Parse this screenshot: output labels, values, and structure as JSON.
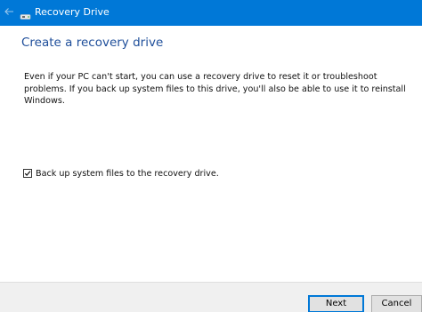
{
  "window": {
    "title": "Recovery Drive"
  },
  "main": {
    "heading": "Create a recovery drive",
    "description": "Even if your PC can't start, you can use a recovery drive to reset it or troubleshoot problems. If you back up system files to this drive, you'll also be able to use it to reinstall Windows.",
    "backup_checkbox": {
      "label": "Back up system files to the recovery drive.",
      "checked": true
    }
  },
  "footer": {
    "next_label": "Next",
    "cancel_label": "Cancel"
  },
  "colors": {
    "titlebar": "#0078d7",
    "heading": "#1e4e9a",
    "default_button_border": "#0078d7",
    "footer": "#f0f0f0"
  },
  "icons": {
    "back": "back-arrow-icon",
    "app": "drive-icon",
    "check": "checkmark-icon"
  }
}
